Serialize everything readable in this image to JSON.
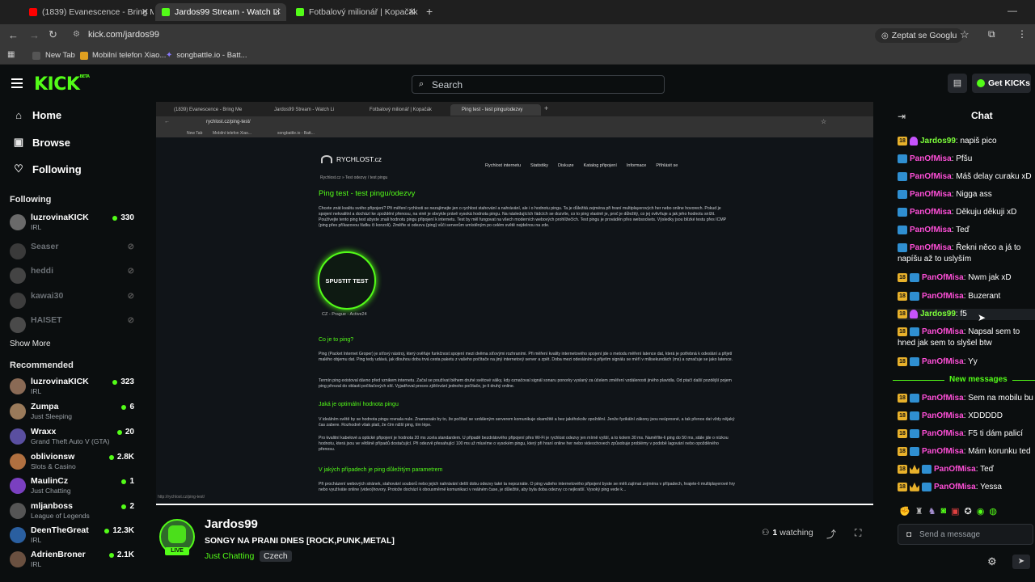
{
  "browser": {
    "tabs": [
      {
        "title": "(1839) Evanescence - Bring Me",
        "active": false
      },
      {
        "title": "Jardos99 Stream - Watch Li",
        "active": true
      },
      {
        "title": "Fotbalový milionář | Kopačák",
        "active": false
      }
    ],
    "url": "kick.com/jardos99",
    "ask_google": "Zeptat se Googlu",
    "bookmarks": [
      "New Tab",
      "Mobilní telefon Xiao...",
      "songbattle.io - Batt..."
    ]
  },
  "header": {
    "logo": "KICK",
    "logo_sup": "BETA",
    "search_placeholder": "Search",
    "get_kicks": "Get KICKs"
  },
  "sidebar": {
    "nav": [
      {
        "label": "Home",
        "icon": "home-icon"
      },
      {
        "label": "Browse",
        "icon": "browse-icon"
      },
      {
        "label": "Following",
        "icon": "heart-icon"
      }
    ],
    "following_title": "Following",
    "following": [
      {
        "name": "luzrovinaKICK",
        "sub": "IRL",
        "viewers": "330",
        "live": true
      },
      {
        "name": "Seaser",
        "sub": "",
        "viewers": "",
        "live": false
      },
      {
        "name": "heddi",
        "sub": "",
        "viewers": "",
        "live": false
      },
      {
        "name": "kawai30",
        "sub": "",
        "viewers": "",
        "live": false
      },
      {
        "name": "HAISET",
        "sub": "",
        "viewers": "",
        "live": false
      }
    ],
    "show_more": "Show More",
    "recommended_title": "Recommended",
    "recommended": [
      {
        "name": "luzrovinaKICK",
        "sub": "IRL",
        "viewers": "323",
        "color": "#8a6a55"
      },
      {
        "name": "Zumpa",
        "sub": "Just Sleeping",
        "viewers": "6",
        "color": "#9a7a5a"
      },
      {
        "name": "Wraxx",
        "sub": "Grand Theft Auto V (GTA)",
        "viewers": "20",
        "color": "#5a4fa0"
      },
      {
        "name": "oblivionsw",
        "sub": "Slots & Casino",
        "viewers": "2.8K",
        "color": "#b07040"
      },
      {
        "name": "MaulinCz",
        "sub": "Just Chatting",
        "viewers": "1",
        "color": "#7a40c0"
      },
      {
        "name": "mljanboss",
        "sub": "League of Legends",
        "viewers": "2",
        "color": "#555"
      },
      {
        "name": "DeenTheGreat",
        "sub": "IRL",
        "viewers": "12.3K",
        "color": "#2a5fa0"
      },
      {
        "name": "AdrienBroner",
        "sub": "IRL",
        "viewers": "2.1K",
        "color": "#6a5040"
      }
    ]
  },
  "stream": {
    "inner_tabs": [
      "(1839) Evanescence - Bring Me",
      "Jardos99 Stream - Watch Li",
      "Fotbalový milionář | Kopačák",
      "Ping test - test pingu/odezvy"
    ],
    "inner_url": "rychlost.cz/ping-test/",
    "inner_bookmarks": [
      "New Tab",
      "Mobilní telefon Xiao...",
      "songbattle.io - Batt..."
    ],
    "site_logo": "RYCHLOST.cz",
    "site_nav": [
      "Rychlost internetu",
      "Statistiky",
      "Diskuze",
      "Katalog připojení",
      "Informace",
      "Přihlásit se"
    ],
    "breadcrumb": "Rychlost.cz  »  Test odezvy / test pingu",
    "heading": "Ping test - test pingu/odezvy",
    "intro": "Chcete znát kvalitu svého připojení? Při měření rychlosti se nezajímejte jen o rychlost stahování a nahrávání, ale i o hodnotu pingu. Ta je důležitá zejména při hraní multiplayerových her nebo online hovorech. Pokud je spojení nekvalitní a dochází ke zpoždění přenosu, na vině je obvykle právě vysoká hodnota pingu. Na následujících řádcích se dozvíte, co to ping vlastně je, proč je důležitý, co jej ovlivňuje a jak jeho hodnotu snížit. Používejte tento ping test abyste znali hodnotu pingu připojení k internetu. Test by měl fungovat na všech moderních webových prohlížečích. Test pingu je prováděn přes websockets. Výsledky jsou blízké testu přes ICMP (ping přes příkazovou řádku či konzoli). Změřte si odezvu (ping) vůči serverům umístěným po celém světě nejdelnou na zde.",
    "start_button": "SPUSTIT TEST",
    "server": "CZ - Prague - Active24",
    "h_what": "Co je to ping?",
    "p_what": "Ping (Packet Internet Groper) je síťový nástroj, který ověřuje funkčnost spojení mezi dvěma síťovými rozhraními. Při měření kvality internetového spojení jde o metodu měření latence dat, která je potřebná k odeslání a přijetí malého objemu dat. Ping tedy udává, jak dlouhou dobu trvá cesta paketu z vašeho počítače na jiný internetový server a zpět. Doba mezi odesláním a přijetím signálu se měří v milisekundách (ms) a označuje se jako latence.",
    "p_what2": "Termín ping existoval dávno před vznikem internetu. Začal se používat během druhé světové války, kdy označoval signál sonaru ponorky vyslaný za účelem změření vzdálenosti jiného plavidla. Od ptačí další pozdější pojem ping převzal do oblasti počítačových sítí. Vyjadřoval proces zjišťování jednoho počítače, je-li druhý online.",
    "h_optimal": "Jaká je optimální hodnota pingu",
    "p_optimal": "V ideálním světě by se hodnota pingu rovnala nule. Znamenalo by to, že počítač se vzdáleným serverem komunikuje okamžitě a bez jakéhokoliv zpoždění. Jenže fyzikální zákony jsou neúprosné, a tak přenos dat vždy nějaký čas zabere. Rozhodně však platí, že čím nižší ping, tím lépe.",
    "p_optimal2": "Pro kvalitní kabelové a optické připojení je hodnota 20 ms zcela standardem. U připadě bezdrátového připojení přes Wi-Fi je rychlost odezvy jen mírně vyšší, a to kolem 30 ms. Naměříte-li ping do 50 ms, stále jde o nízkou hodnotu, která jsou ve většině případů dostačující. Při odezvě přesahující 100 ms už mluvíme o vysokém pingu, který při hraní online her nebo videochovech způsobuje problémy v podobě lagování nebo opožděného přenosu.",
    "h_cases": "V jakých případech je ping důležitým parametrem",
    "p_cases": "Při procházení webových stránek, stahování souborů nebo jejich nahrávání delší dobu odezvy také ta nepoznáte. O ping vašeho internetového připojení byste se měli zajímat zejména v případech, hrajete-li multiplayerové hry nebo využíváte online (video)hovory. Protože dochází k obousměrné komunikaci v reálném čase, je důležité, aby byla doba odezvy co nejkratší. Vysoký ping vede k...",
    "status_url": "http://rychlost.cz/ping-test/"
  },
  "channel": {
    "name": "Jardos99",
    "title": "SONGY NA PRANI DNES [ROCK,PUNK,METAL]",
    "category": "Just Chatting",
    "tag": "Czech",
    "live_badge": "LIVE",
    "watching_count": "1",
    "watching_label": "watching"
  },
  "chat": {
    "title": "Chat",
    "messages": [
      {
        "user": "Jardos99",
        "text": "napiš pico",
        "type": "owner"
      },
      {
        "user": "PanOfMisa",
        "text": "Pfšu",
        "type": "sub"
      },
      {
        "user": "PanOfMisa",
        "text": "Máš delay curaku xD",
        "type": "sub"
      },
      {
        "user": "PanOfMisa",
        "text": "Nigga ass",
        "type": "sub"
      },
      {
        "user": "PanOfMisa",
        "text": "Děkuju děkuji xD",
        "type": "sub"
      },
      {
        "user": "PanOfMisa",
        "text": "Teď",
        "type": "sub"
      },
      {
        "user": "PanOfMisa",
        "text": "Řekni něco a já to napíšu až to uslyším",
        "type": "sub"
      },
      {
        "user": "PanOfMisa",
        "text": "Nwm jak xD",
        "type": "sub"
      },
      {
        "user": "PanOfMisa",
        "text": "Buzerant",
        "type": "sub"
      },
      {
        "user": "Jardos99",
        "text": "f5",
        "type": "owner"
      },
      {
        "user": "PanOfMisa",
        "text": "Napsal sem to hned jak sem to slyšel btw",
        "type": "sub"
      },
      {
        "user": "PanOfMisa",
        "text": "Yy",
        "type": "sub"
      }
    ],
    "new_messages": "New messages",
    "new": [
      {
        "user": "PanOfMisa",
        "text": "Sem na mobilu bu",
        "type": "sub"
      },
      {
        "user": "PanOfMisa",
        "text": "XDDDDD",
        "type": "sub"
      },
      {
        "user": "PanOfMisa",
        "text": "F5 ti dám palicí",
        "type": "sub"
      },
      {
        "user": "PanOfMisa",
        "text": "Mám korunku ted",
        "type": "sub"
      },
      {
        "user": "PanOfMisa",
        "text": "Teď",
        "type": "crown"
      },
      {
        "user": "PanOfMisa",
        "text": "Yessa",
        "type": "crown"
      }
    ],
    "send_placeholder": "Send a message",
    "sub_badge": "18"
  },
  "colors": {
    "accent": "#53fc18",
    "bg": "#0b0e0f",
    "chat_user": "#ff4fd8"
  }
}
